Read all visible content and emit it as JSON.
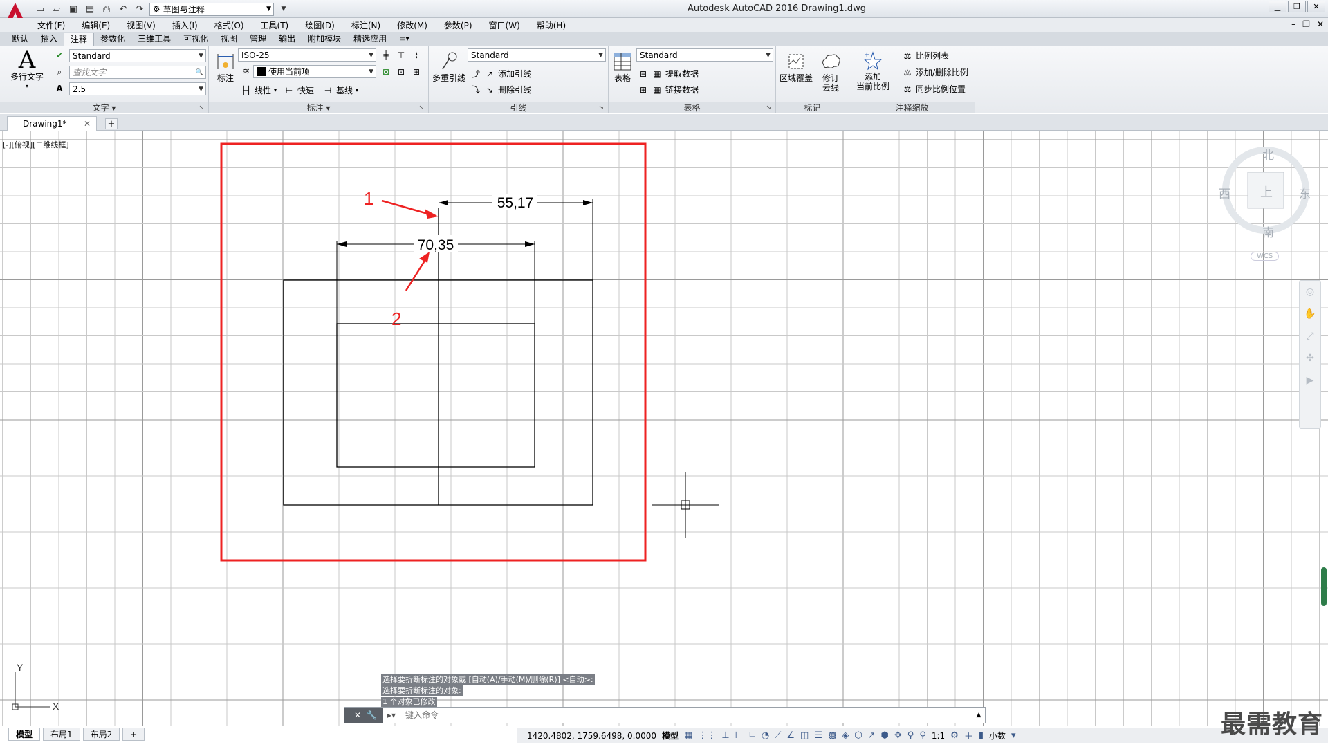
{
  "app": {
    "title": "Autodesk AutoCAD 2016    Drawing1.dwg",
    "workspace": "草图与注释"
  },
  "menu": [
    "文件(F)",
    "编辑(E)",
    "视图(V)",
    "插入(I)",
    "格式(O)",
    "工具(T)",
    "绘图(D)",
    "标注(N)",
    "修改(M)",
    "参数(P)",
    "窗口(W)",
    "帮助(H)"
  ],
  "ribbon_tabs": [
    "默认",
    "插入",
    "注释",
    "参数化",
    "三维工具",
    "可视化",
    "视图",
    "管理",
    "输出",
    "附加模块",
    "精选应用"
  ],
  "ribbon_active_tab": "注释",
  "panels": {
    "text": {
      "title": "文字",
      "mtext_label": "多行文字",
      "style_value": "Standard",
      "find_placeholder": "查找文字",
      "height_value": "2.5"
    },
    "dimension": {
      "title": "标注",
      "dim_label": "标注",
      "style_value": "ISO-25",
      "layer_value": "使用当前项",
      "linear_label": "线性",
      "quick_label": "快速",
      "baseline_label": "基线"
    },
    "leader": {
      "title": "引线",
      "mleader_label": "多重引线",
      "style_value": "Standard",
      "add_label": "添加引线",
      "remove_label": "删除引线"
    },
    "table": {
      "title": "表格",
      "table_label": "表格",
      "style_value": "Standard",
      "extract_label": "提取数据",
      "link_label": "链接数据"
    },
    "markup": {
      "title": "标记",
      "wipeout_label": "区域覆盖",
      "revcloud_label": "修订\n云线"
    },
    "scale": {
      "title": "注释缩放",
      "add_current_label": "添加\n当前比例",
      "scale_list_label": "比例列表",
      "add_delete_label": "添加/删除比例",
      "sync_label": "同步比例位置"
    }
  },
  "doc_tab": "Drawing1*",
  "viewport_label": "[-][俯视][二维线框]",
  "viewcube": {
    "north": "北",
    "south": "南",
    "west": "西",
    "east": "东",
    "face": "上",
    "wcs": "WCS"
  },
  "drawing": {
    "dim_top": "55,17",
    "dim_mid": "70,35",
    "callout_1": "1",
    "callout_2": "2",
    "highlight_color": "#ee2222"
  },
  "command": {
    "history": [
      "选择要折断标注的对象或 [自动(A)/手动(M)/删除(R)] <自动>:",
      "选择要折断标注的对象:",
      "1 个对象已修改"
    ],
    "placeholder": "键入命令"
  },
  "layout_tabs": [
    "模型",
    "布局1",
    "布局2"
  ],
  "status": {
    "coords": "1420.4802, 1759.6498, 0.0000",
    "space": "模型",
    "scale": "1:1",
    "units": "小数"
  },
  "ucs": {
    "y": "Y",
    "x": "X"
  },
  "watermark": "最需教育"
}
